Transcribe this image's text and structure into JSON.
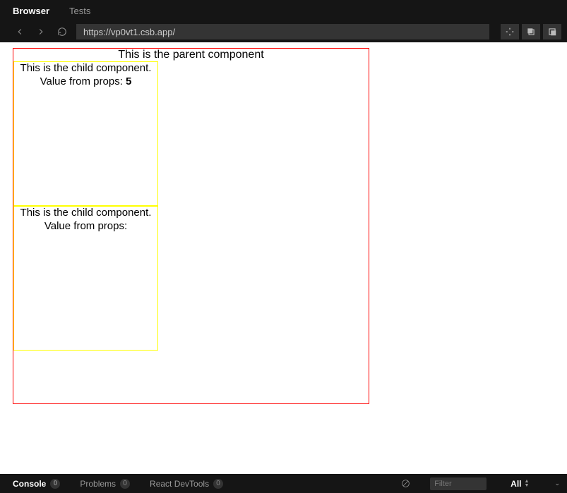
{
  "tabs": {
    "browser": "Browser",
    "tests": "Tests"
  },
  "nav": {
    "url": "https://vp0vt1.csb.app/"
  },
  "preview": {
    "parent_title": "This is the parent component",
    "child1": {
      "line1": "This is the child component.",
      "line2_prefix": "Value from props: ",
      "value": "5"
    },
    "child2": {
      "line1": "This is the child component.",
      "line2_prefix": "Value from props:",
      "value": ""
    }
  },
  "console": {
    "console_label": "Console",
    "console_count": "0",
    "problems_label": "Problems",
    "problems_count": "0",
    "react_label": "React DevTools",
    "react_count": "0",
    "filter_placeholder": "Filter",
    "level": "All"
  }
}
